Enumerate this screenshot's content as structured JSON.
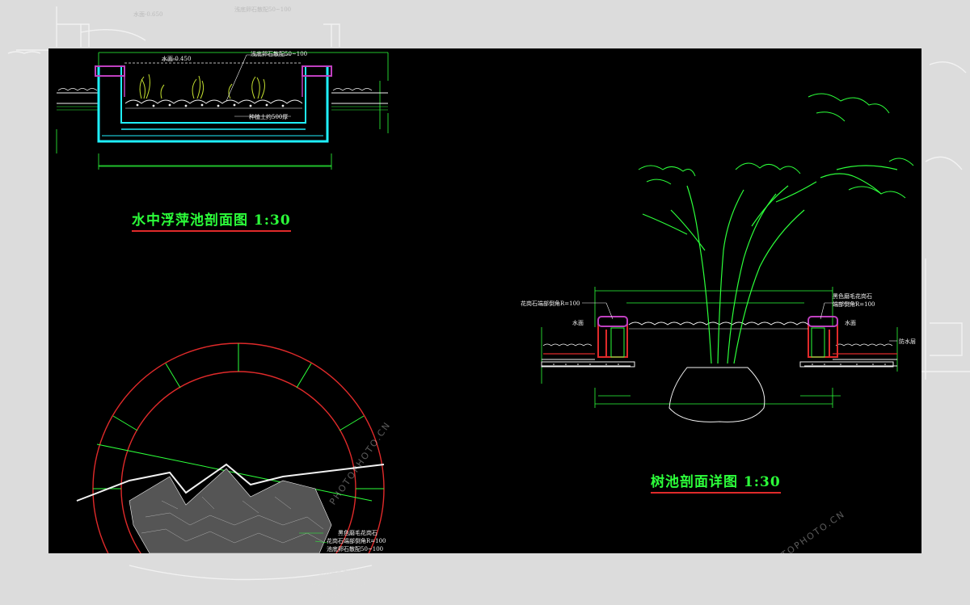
{
  "colors": {
    "canvas": "#000000",
    "frame": "#dcdcdc",
    "green": "#2cff3a",
    "cyan": "#1ff0ff",
    "red": "#e02a2a",
    "magenta": "#c040c0",
    "white": "#f2f2f2"
  },
  "pool_section": {
    "title": "水中浮萍池剖面图 1:30",
    "label_water_level": "水面-0.450",
    "label_pebbles": "浅底卵石散配50~100",
    "label_soil": "种植土约500厚"
  },
  "tree_pit_section": {
    "title": "树池剖面详图 1:30",
    "label_granite_left": "花岗石端部倒角R=100",
    "label_granite_right_1": "黑色磨毛花岗石",
    "label_granite_right_2": "端部倒角R=100",
    "label_water_left": "水面",
    "label_water_right": "水面",
    "label_waterproof": "防水层"
  },
  "circle_plan": {
    "label_1": "黑色磨毛花岗石",
    "label_2": "花岗石端部倒角R=100",
    "label_3": "池底卵石散配50~100"
  },
  "background_labels": {
    "top_water": "水面-0.650",
    "top_pebbles": "浅底卵石散配50~100",
    "bottom_1": "黑色磨毛花岗石",
    "bottom_2": "花岗石端部倒角R=100",
    "bottom_3": "池底卵石散配50~100"
  },
  "watermark": {
    "text": "PHOTOPHOTO.CN"
  }
}
